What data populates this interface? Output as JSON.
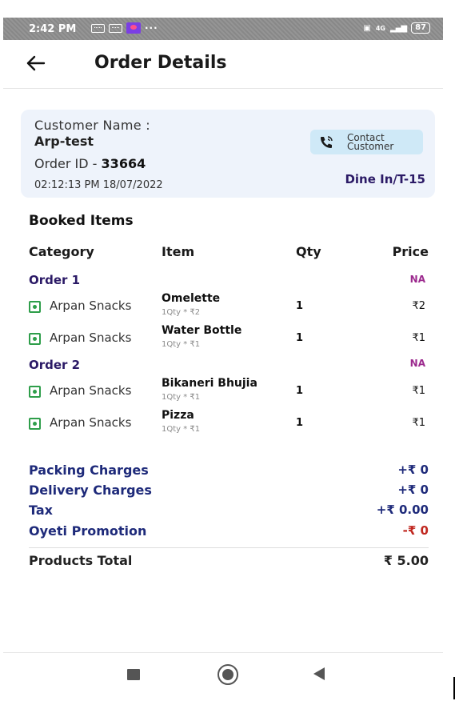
{
  "status_bar": {
    "time": "2:42 PM",
    "dots": "···",
    "network": "4G",
    "battery": "87"
  },
  "header": {
    "back_icon": "arrow-left-icon",
    "title": "Order Details"
  },
  "customer": {
    "name_label": "Customer Name :",
    "name": "Arp-test",
    "order_id_label": "Order ID - ",
    "order_id": "33664",
    "datetime": "02:12:13 PM 18/07/2022",
    "contact_label": "Contact\nCustomer",
    "contact_icon": "phone-icon",
    "dine_type": "Dine In/T-15"
  },
  "booked_items": {
    "title": "Booked Items",
    "columns": [
      "Category",
      "Item",
      "Qty",
      "Price"
    ],
    "orders": [
      {
        "label": "Order 1",
        "status": "NA",
        "items": [
          {
            "category": "Arpan Snacks",
            "name": "Omelette",
            "detail": "1Qty * ₹2",
            "qty": "1",
            "price": "₹2"
          },
          {
            "category": "Arpan Snacks",
            "name": "Water Bottle",
            "detail": "1Qty * ₹1",
            "qty": "1",
            "price": "₹1"
          }
        ]
      },
      {
        "label": "Order 2",
        "status": "NA",
        "items": [
          {
            "category": "Arpan Snacks",
            "name": "Bikaneri Bhujia",
            "detail": "1Qty * ₹1",
            "qty": "1",
            "price": "₹1"
          },
          {
            "category": "Arpan Snacks",
            "name": "Pizza",
            "detail": "1Qty * ₹1",
            "qty": "1",
            "price": "₹1"
          }
        ]
      }
    ]
  },
  "charges": [
    {
      "label": "Packing Charges",
      "value": "+₹ 0"
    },
    {
      "label": "Delivery Charges",
      "value": "+₹ 0"
    },
    {
      "label": "Tax",
      "value": "+₹ 0.00"
    },
    {
      "label": "Oyeti Promotion",
      "value": "-₹ 0"
    }
  ],
  "total": {
    "label": "Products Total",
    "value": "₹ 5.00"
  },
  "colors": {
    "accent_navy": "#1e2a7a",
    "order_purple": "#2b1a66",
    "na_magenta": "#9c2a8e",
    "promo_red": "#c0271f",
    "card_bg": "#eef3fb",
    "contact_bg": "#cfe9f7",
    "veg_green": "#2e9e4a"
  }
}
